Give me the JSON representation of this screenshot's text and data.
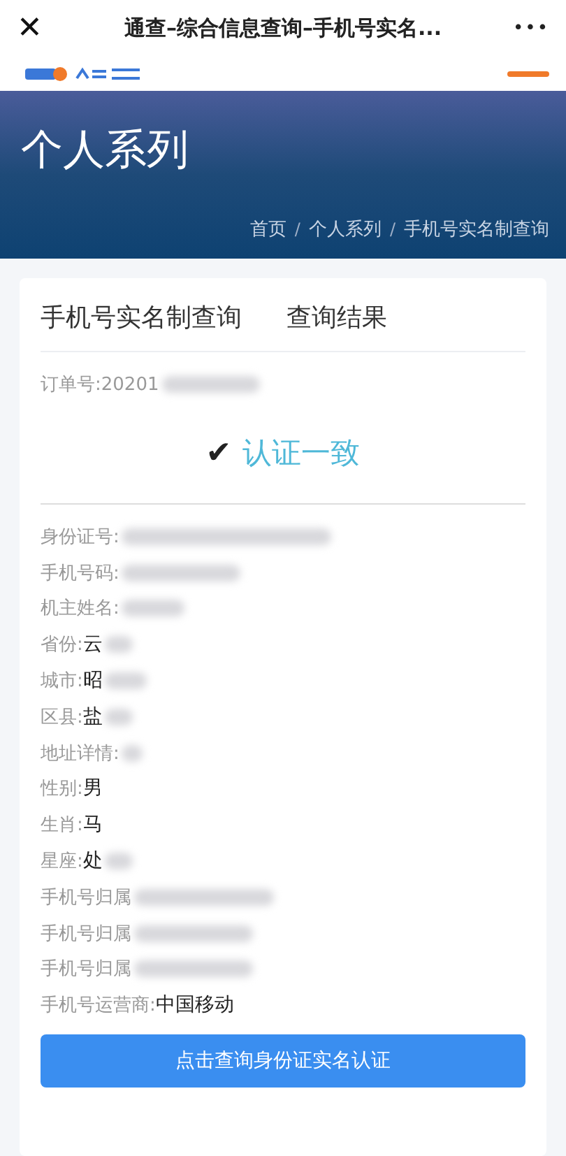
{
  "top_bar": {
    "close": "✕",
    "title": "通查–综合信息查询–手机号实名...",
    "more": "•••"
  },
  "banner": {
    "title": "个人系列",
    "breadcrumb": [
      "首页",
      "个人系列",
      "手机号实名制查询"
    ],
    "separator": "/"
  },
  "card": {
    "tabs": [
      {
        "label": "手机号实名制查询"
      },
      {
        "label": "查询结果"
      }
    ],
    "order": {
      "label": "订单号:",
      "value": "20201",
      "redacted": true
    },
    "result": {
      "mark": "✔",
      "text": "认证一致"
    },
    "rows": [
      {
        "label": "身份证号:",
        "value": "",
        "redacted": true
      },
      {
        "label": "手机号码:",
        "value": "",
        "redacted": true
      },
      {
        "label": "机主姓名:",
        "value": "",
        "redacted": true
      },
      {
        "label": "省份:",
        "value": "云",
        "redacted": true
      },
      {
        "label": "城市:",
        "value": "昭",
        "redacted": true
      },
      {
        "label": "区县:",
        "value": "盐",
        "redacted": true
      },
      {
        "label": "地址详情:",
        "value": "",
        "redacted": true
      },
      {
        "label": "性别:",
        "value": "男",
        "redacted": false
      },
      {
        "label": "生肖:",
        "value": "马",
        "redacted": false
      },
      {
        "label": "星座:",
        "value": "处",
        "redacted": true
      },
      {
        "label": "手机号归属",
        "value": "",
        "redacted": true
      },
      {
        "label": "手机号归属",
        "value": "",
        "redacted": true
      },
      {
        "label": "手机号归属",
        "value": "",
        "redacted": true
      },
      {
        "label": "手机号运营商:",
        "value": "中国移动",
        "redacted": false
      }
    ],
    "button": "点击查询身份证实名认证"
  }
}
